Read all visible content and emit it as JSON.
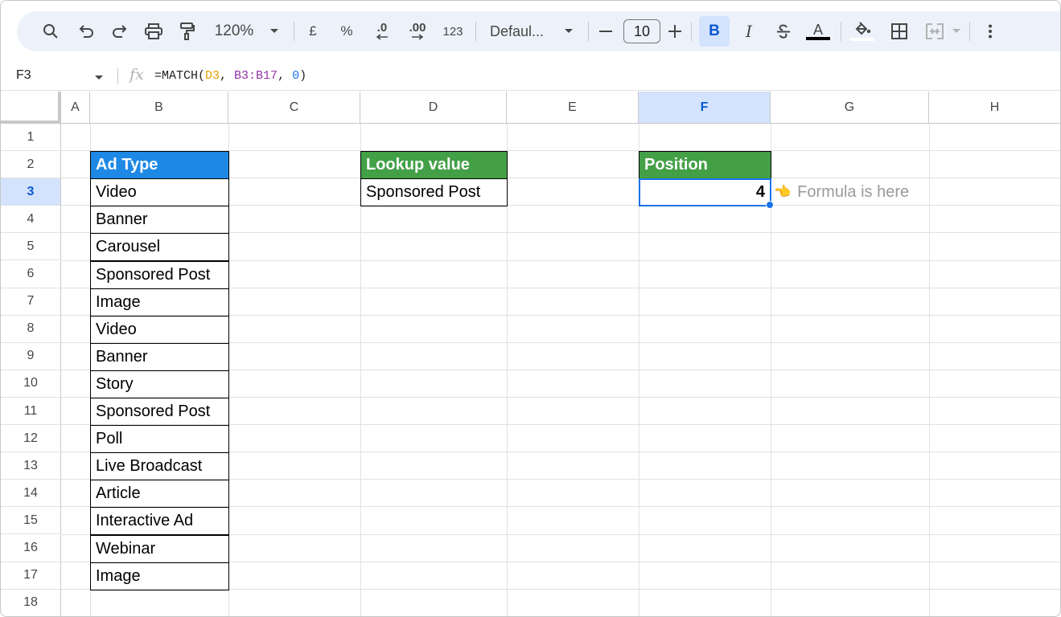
{
  "toolbar": {
    "zoom": "120%",
    "currency": "£",
    "percent": "%",
    "decrease_decimal": ".0",
    "increase_decimal": ".00",
    "number_format": "123",
    "font": "Defaul...",
    "font_size": "10",
    "bold": "B",
    "italic": "I",
    "text_color": "A"
  },
  "formula_bar": {
    "cell_ref": "F3",
    "fx": "fx",
    "formula_prefix": "=MATCH(",
    "arg1": "D3",
    "sep1": ", ",
    "arg2": "B3:B17",
    "sep2": ", ",
    "arg3": "0",
    "formula_suffix": ")"
  },
  "grid": {
    "columns": [
      "A",
      "B",
      "C",
      "D",
      "E",
      "F",
      "G",
      "H"
    ],
    "rows": [
      "1",
      "2",
      "3",
      "4",
      "5",
      "6",
      "7",
      "8",
      "9",
      "10",
      "11",
      "12",
      "13",
      "14",
      "15",
      "16",
      "17",
      "18"
    ],
    "selected_column": "F",
    "selected_row": "3"
  },
  "ad_table": {
    "header": "Ad Type",
    "items": [
      "Video",
      "Banner",
      "Carousel",
      "Sponsored Post",
      "Image",
      "Video",
      "Banner",
      "Story",
      "Sponsored Post",
      "Poll",
      "Live Broadcast",
      "Article",
      "Interactive Ad",
      "Webinar",
      "Image"
    ]
  },
  "lookup": {
    "header": "Lookup value",
    "value": "Sponsored Post"
  },
  "position": {
    "header": "Position",
    "value": "4"
  },
  "note": {
    "icon": "👈",
    "text": "Formula is here"
  },
  "colors": {
    "blue_header": "#1e88e5",
    "green_header": "#43a047",
    "selection": "#1a73e8"
  }
}
